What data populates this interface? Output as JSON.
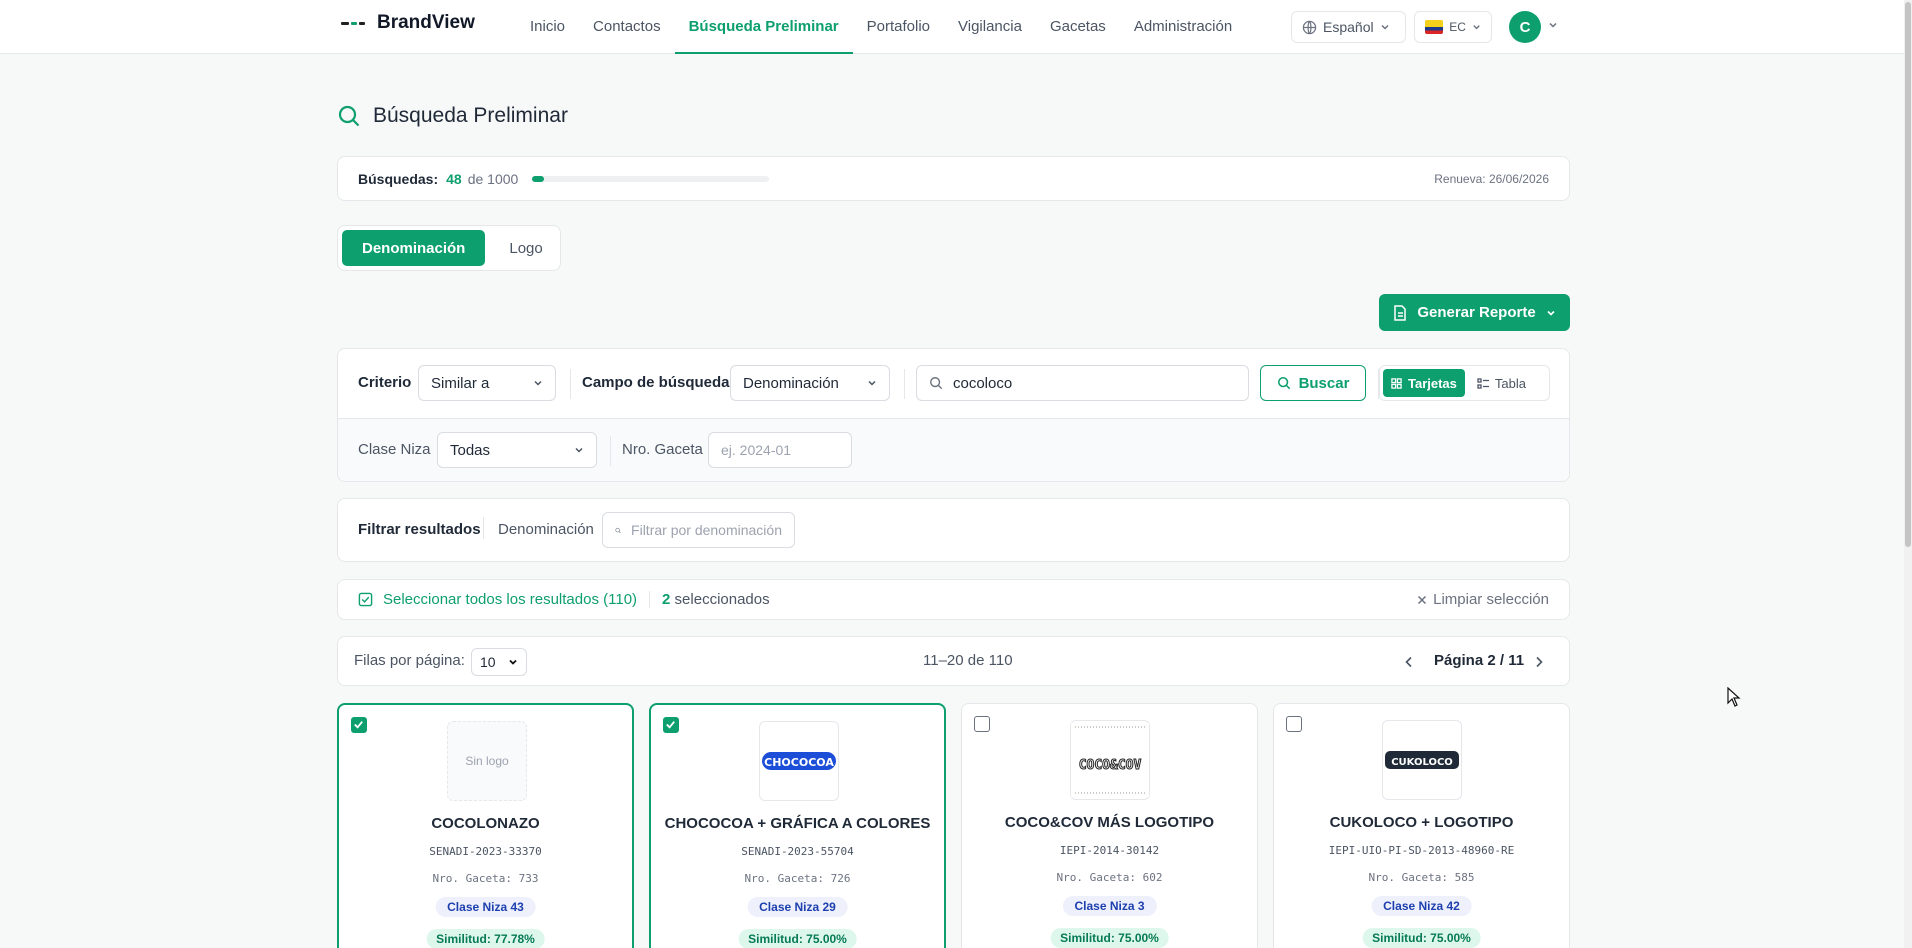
{
  "app": {
    "name": "BrandView"
  },
  "nav": [
    {
      "label": "Inicio"
    },
    {
      "label": "Contactos"
    },
    {
      "label": "Búsqueda Preliminar",
      "active": true
    },
    {
      "label": "Portafolio"
    },
    {
      "label": "Vigilancia"
    },
    {
      "label": "Gacetas"
    },
    {
      "label": "Administración"
    }
  ],
  "header": {
    "language": "Español",
    "country": "EC",
    "avatar_initial": "C"
  },
  "page": {
    "title": "Búsqueda Preliminar"
  },
  "quota": {
    "label": "Búsquedas:",
    "used": "48",
    "of_text": "de 1000",
    "fraction": 0.048,
    "renew": "Renueva: 26/06/2026"
  },
  "mode": {
    "denominacion": "Denominación",
    "logo": "Logo",
    "selected": "Denominación"
  },
  "report": {
    "label": "Generar Reporte"
  },
  "search": {
    "criterio_label": "Criterio",
    "criterio_value": "Similar a",
    "campo_label": "Campo de búsqueda",
    "campo_value": "Denominación",
    "query": "cocoloco",
    "buscar": "Buscar",
    "view_cards": "Tarjetas",
    "view_table": "Tabla",
    "clase_label": "Clase Niza",
    "clase_value": "Todas",
    "gaceta_label": "Nro. Gaceta",
    "gaceta_placeholder": "ej. 2024-01"
  },
  "filter": {
    "title": "Filtrar resultados",
    "field_label": "Denominación",
    "placeholder": "Filtrar por denominación"
  },
  "selection": {
    "select_all": "Seleccionar todos los resultados (110)",
    "count": "2",
    "count_suffix": "seleccionados",
    "clear": "Limpiar selección"
  },
  "pagination": {
    "rows_label": "Filas por página:",
    "rows_value": "10",
    "range": "11–20 de 110",
    "page": "Página 2 / 11"
  },
  "results": [
    {
      "name": "COCOLONAZO",
      "code": "SENADI-2023-33370",
      "gaceta": "Nro. Gaceta: 733",
      "clase": "Clase Niza 43",
      "similitud": "Similitud: 77.78%",
      "selected": true,
      "logo_text": "Sin logo"
    },
    {
      "name": "CHOCOCOA + GRÁFICA A COLORES",
      "code": "SENADI-2023-55704",
      "gaceta": "Nro. Gaceta: 726",
      "clase": "Clase Niza 29",
      "similitud": "Similitud: 75.00%",
      "selected": true,
      "logo_text": "CHOCOCOA"
    },
    {
      "name": "COCO&COV MÁS LOGOTIPO",
      "code": "IEPI-2014-30142",
      "gaceta": "Nro. Gaceta: 602",
      "clase": "Clase Niza 3",
      "similitud": "Similitud: 75.00%",
      "selected": false,
      "logo_text": "COCO&COV"
    },
    {
      "name": "CUKOLOCO + LOGOTIPO",
      "code": "IEPI-UIO-PI-SD-2013-48960-RE",
      "gaceta": "Nro. Gaceta: 585",
      "clase": "Clase Niza 42",
      "similitud": "Similitud: 75.00%",
      "selected": false,
      "logo_text": "CUKOLOCO"
    }
  ]
}
